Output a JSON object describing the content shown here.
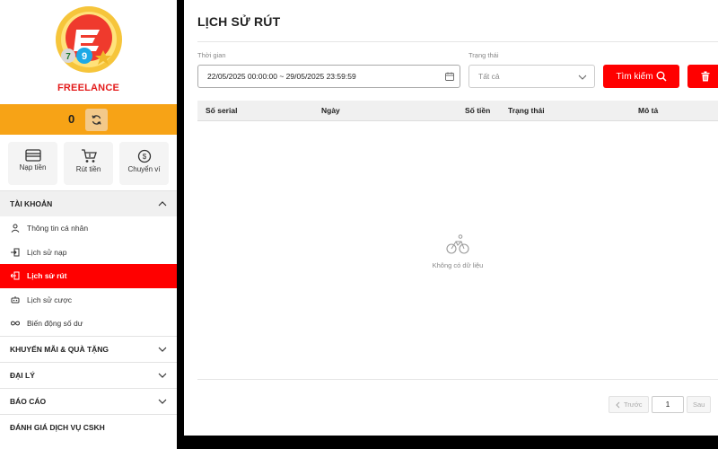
{
  "brand": {
    "name": "FREELANCE"
  },
  "balance": {
    "value": "0"
  },
  "quick_actions": [
    {
      "label": "Nạp tiền",
      "icon": "card-icon"
    },
    {
      "label": "Rút tiền",
      "icon": "cart-icon"
    },
    {
      "label": "Chuyển ví",
      "icon": "transfer-icon"
    }
  ],
  "sidebar": {
    "account_header": "TÀI KHOẢN",
    "account_items": [
      {
        "label": "Thông tin cá nhân",
        "icon": "user-icon"
      },
      {
        "label": "Lịch sử nạp",
        "icon": "deposit-icon"
      },
      {
        "label": "Lịch sử rút",
        "icon": "withdraw-icon"
      },
      {
        "label": "Lịch sử cược",
        "icon": "bet-icon"
      },
      {
        "label": "Biến động số dư",
        "icon": "infinity-icon"
      }
    ],
    "sections": [
      {
        "label": "KHUYẾN MÃI & QUÀ TẶNG"
      },
      {
        "label": "ĐẠI LÝ"
      },
      {
        "label": "BÁO CÁO"
      },
      {
        "label": "ĐÁNH GIÁ DỊCH VỤ CSKH"
      }
    ]
  },
  "main": {
    "title": "LỊCH SỬ RÚT",
    "time_label": "Thời gian",
    "time_value": "22/05/2025 00:00:00 ~ 29/05/2025 23:59:59",
    "status_label": "Trạng thái",
    "status_value": "Tất cả",
    "search_label": "Tìm kiếm",
    "columns": [
      "Số serial",
      "Ngày",
      "Số tiền",
      "Trạng thái",
      "Mô tả"
    ],
    "empty_text": "Không có dữ liệu",
    "prev_label": "Trước",
    "next_label": "Sau",
    "page": "1"
  },
  "colors": {
    "accent": "#ff0000",
    "balance_bar": "#f7a316",
    "brand": "#e31b1b"
  }
}
